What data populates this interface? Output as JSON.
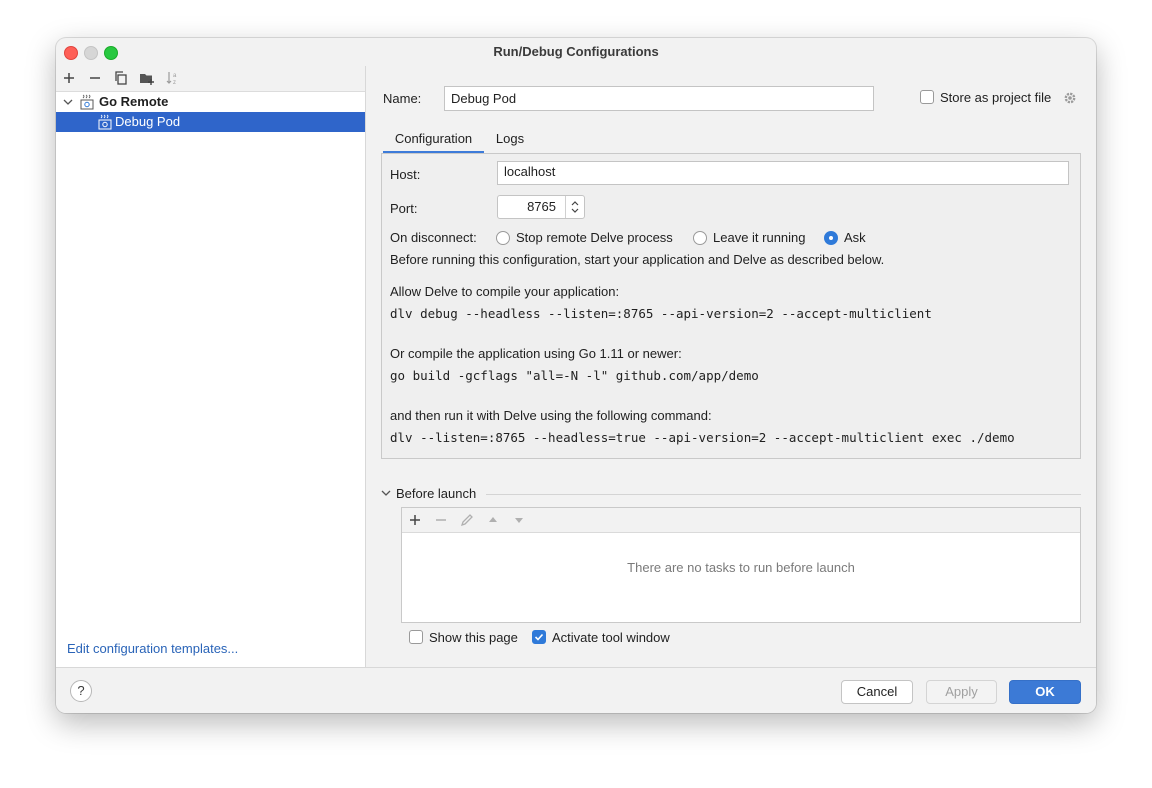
{
  "window": {
    "title": "Run/Debug Configurations"
  },
  "tree": {
    "group_label": "Go Remote",
    "item_label": "Debug Pod"
  },
  "left_footer": {
    "edit_templates_label": "Edit configuration templates..."
  },
  "name_row": {
    "label": "Name:",
    "value": "Debug Pod",
    "store_label": "Store as project file",
    "store_checked": false
  },
  "tabs": [
    {
      "label": "Configuration",
      "active": true
    },
    {
      "label": "Logs",
      "active": false
    }
  ],
  "config": {
    "host_label": "Host:",
    "host_value": "localhost",
    "port_label": "Port:",
    "port_value": "8765",
    "disconnect_label": "On disconnect:",
    "disconnect_options": [
      {
        "label": "Stop remote Delve process",
        "selected": false
      },
      {
        "label": "Leave it running",
        "selected": false
      },
      {
        "label": "Ask",
        "selected": true
      }
    ],
    "info_line": "Before running this configuration, start your application and Delve as described below.",
    "allow_label": "Allow Delve to compile your application:",
    "allow_cmd": "dlv debug --headless --listen=:8765 --api-version=2 --accept-multiclient",
    "compile_label": "Or compile the application using Go 1.11 or newer:",
    "compile_cmd": "go build -gcflags \"all=-N -l\" github.com/app/demo",
    "run_label": "and then run it with Delve using the following command:",
    "run_cmd": "dlv --listen=:8765 --headless=true --api-version=2 --accept-multiclient exec ./demo"
  },
  "before_launch": {
    "header": "Before launch",
    "empty_message": "There are no tasks to run before launch",
    "show_page_label": "Show this page",
    "show_page_checked": false,
    "activate_label": "Activate tool window",
    "activate_checked": true
  },
  "buttons": {
    "help": "?",
    "cancel": "Cancel",
    "apply": "Apply",
    "ok": "OK"
  },
  "colors": {
    "selection": "#2f65ca",
    "accent": "#2f7ad9",
    "link": "#2a64b8",
    "ok_button": "#3c7ad6"
  }
}
